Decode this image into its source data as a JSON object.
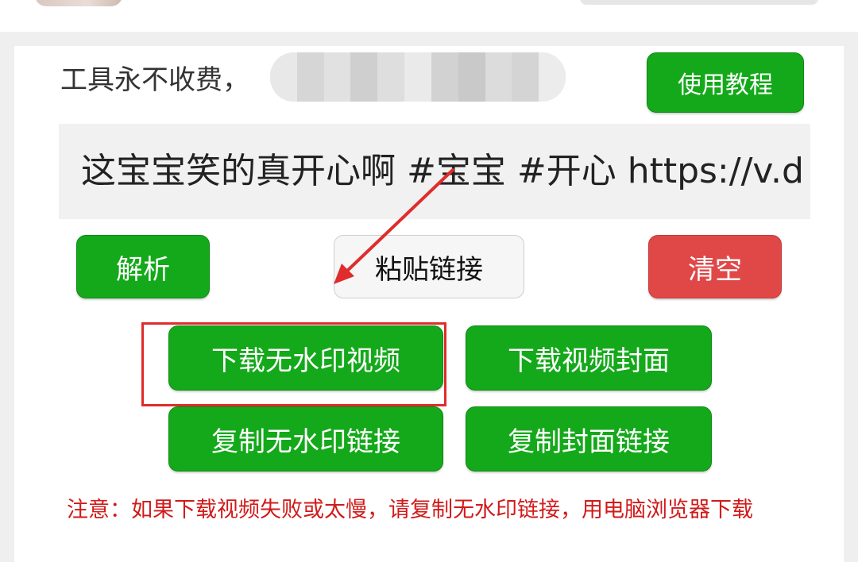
{
  "header": {
    "notice": "工具永不收费，",
    "tutorial_label": "使用教程"
  },
  "input": {
    "value": "这宝宝笑的真开心啊 #宝宝  #开心  https://v.d"
  },
  "actions": {
    "parse_label": "解析",
    "paste_label": "粘贴链接",
    "clear_label": "清空"
  },
  "downloads": {
    "download_video_label": "下载无水印视频",
    "download_cover_label": "下载视频封面",
    "copy_video_link_label": "复制无水印链接",
    "copy_cover_link_label": "复制封面链接"
  },
  "warning": "注意：如果下载视频失败或太慢，请复制无水印链接，用电脑浏览器下载",
  "colors": {
    "primary_green": "#14a91a",
    "danger_red": "#e04848",
    "annotation_red": "#e02c2c",
    "warning_red": "#d11a1a"
  }
}
